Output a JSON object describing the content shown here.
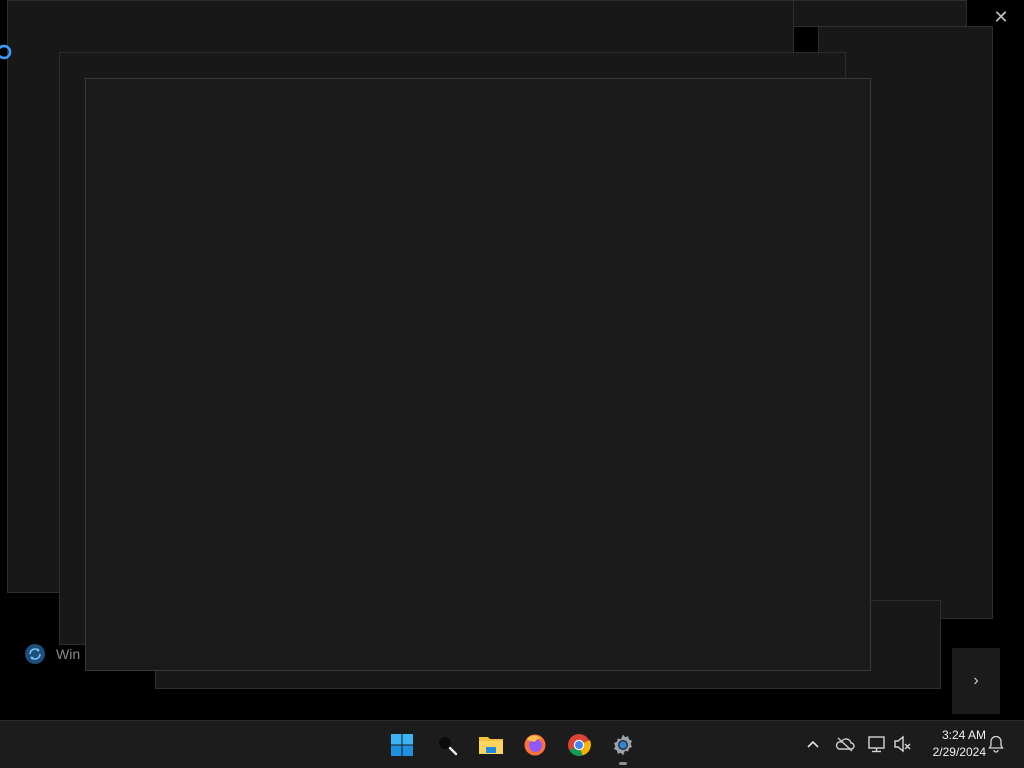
{
  "background_app": {
    "close_glyph": "✕",
    "status_text": "Win",
    "next_glyph": "›"
  },
  "taskbar": {
    "apps": [
      {
        "name": "Start",
        "icon": "windows-logo-icon"
      },
      {
        "name": "Search",
        "icon": "search-icon"
      },
      {
        "name": "File Explorer",
        "icon": "folder-icon"
      },
      {
        "name": "Firefox",
        "icon": "firefox-icon"
      },
      {
        "name": "Google Chrome",
        "icon": "chrome-icon"
      },
      {
        "name": "Settings",
        "icon": "gear-icon",
        "active": true
      }
    ],
    "tray": {
      "overflow_glyph": "^",
      "icons": [
        "onedrive-offline-icon",
        "network-icon",
        "volume-muted-icon",
        "notification-bell-icon"
      ]
    },
    "clock": {
      "time": "3:24 AM",
      "date": "2/29/2024"
    }
  },
  "colors": {
    "accent": "#0078d4",
    "window_bg": "#181818",
    "taskbar_bg": "#1c1c1c"
  }
}
